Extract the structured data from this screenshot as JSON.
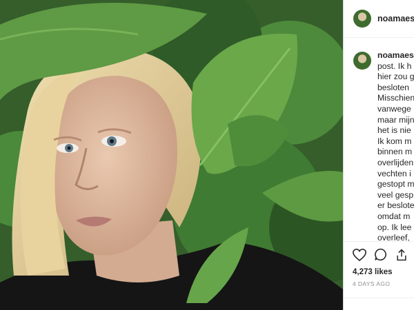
{
  "post": {
    "username": "noamaes",
    "caption_lines": [
      "noamaest",
      "post. Ik h",
      "hier zou g",
      "besloten",
      "Misschien",
      "vanwege",
      "maar mijn",
      "het is nie",
      "Ik kom m",
      "binnen m",
      "overlijden",
      "vechten i",
      "gestopt m",
      "veel gesp",
      "er beslote",
      "omdat m",
      "op. Ik lee",
      "overleef,"
    ],
    "likes": "4,273 likes",
    "time_ago": "4 DAYS AGO"
  },
  "icons": [
    "heart-icon",
    "comment-icon",
    "share-icon"
  ],
  "colors": {
    "text": "#262626",
    "muted": "#8e8e8e",
    "border": "#dbdbdb"
  }
}
